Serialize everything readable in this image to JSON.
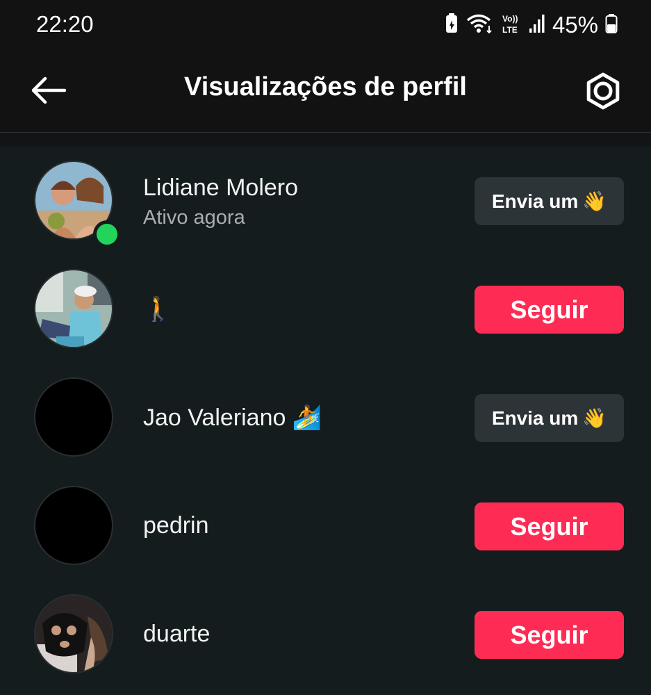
{
  "status_bar": {
    "time": "22:20",
    "battery_percent": "45%"
  },
  "header": {
    "title": "Visualizações de perfil"
  },
  "list": {
    "rows": [
      {
        "name": "Lidiane Molero",
        "subtitle": "Ativo agora",
        "online": true,
        "action": "Envia um",
        "action_type": "wave"
      },
      {
        "name": "🚶",
        "subtitle": "",
        "online": false,
        "action": "Seguir",
        "action_type": "follow"
      },
      {
        "name": "Jao Valeriano 🏄",
        "subtitle": "",
        "online": false,
        "action": "Envia um",
        "action_type": "wave"
      },
      {
        "name": "pedrin",
        "subtitle": "",
        "online": false,
        "action": "Seguir",
        "action_type": "follow"
      },
      {
        "name": "duarte",
        "subtitle": "",
        "online": false,
        "action": "Seguir",
        "action_type": "follow"
      }
    ]
  },
  "colors": {
    "follow": "#fe2c55",
    "wave_button": "#2d3437",
    "online": "#22d35c",
    "background": "#141c1e",
    "bar": "#121212"
  },
  "icons": {
    "back": "arrow-left-icon",
    "settings": "gear-icon",
    "wave": "waving-hand-icon"
  }
}
